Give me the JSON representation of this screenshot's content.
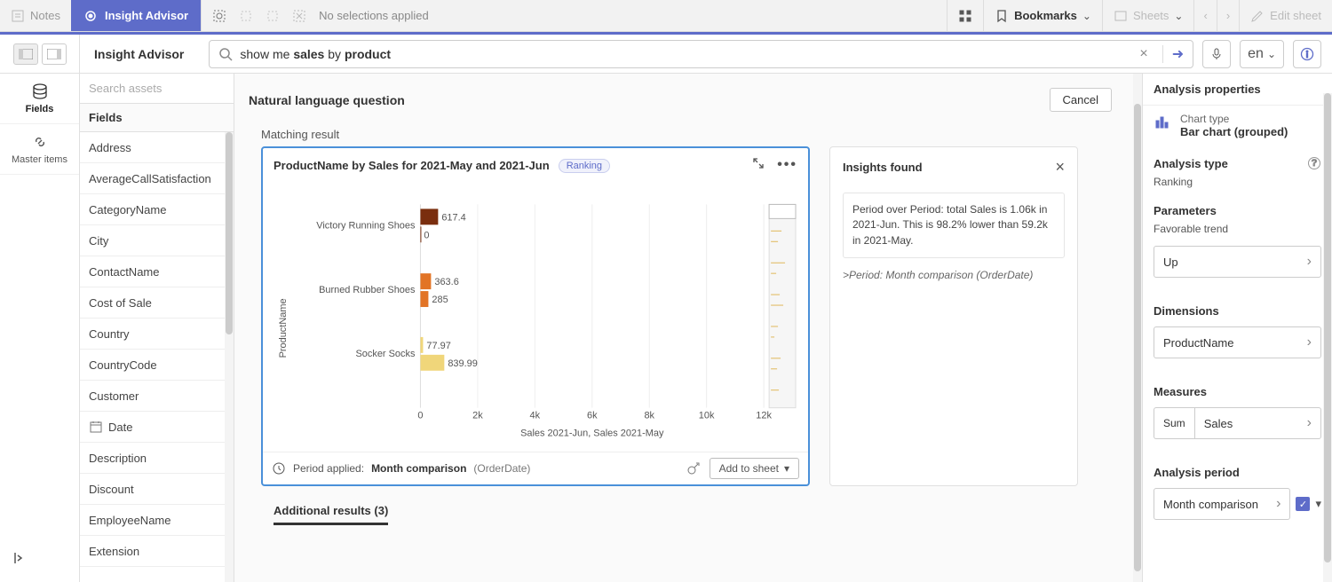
{
  "topbar": {
    "notes": "Notes",
    "insight": "Insight Advisor",
    "no_selections": "No selections applied",
    "bookmarks": "Bookmarks",
    "sheets": "Sheets",
    "edit_sheet": "Edit sheet"
  },
  "header": {
    "title": "Insight Advisor",
    "search_prefix": "show me ",
    "search_kw1": "sales",
    "search_mid": " by ",
    "search_kw2": "product",
    "lang": "en"
  },
  "leftnav": {
    "fields": "Fields",
    "master": "Master items"
  },
  "fields_panel": {
    "search_placeholder": "Search assets",
    "header": "Fields",
    "items": [
      "Address",
      "AverageCallSatisfaction",
      "CategoryName",
      "City",
      "ContactName",
      "Cost of Sale",
      "Country",
      "CountryCode",
      "Customer",
      "Date",
      "Description",
      "Discount",
      "EmployeeName",
      "Extension"
    ]
  },
  "main": {
    "nl_title": "Natural language question",
    "cancel": "Cancel",
    "matching": "Matching result",
    "additional": "Additional results (3)"
  },
  "chart_card": {
    "title": "ProductName by Sales for 2021-May and 2021-Jun",
    "badge": "Ranking",
    "period_applied_label": "Period applied:",
    "period_value": "Month comparison",
    "period_field": "(OrderDate)",
    "add_to_sheet": "Add to sheet"
  },
  "insights": {
    "title": "Insights found",
    "body": "Period over Period: total Sales is 1.06k in 2021-Jun. This is 98.2% lower than 59.2k in 2021-May.",
    "sub": ">Period: Month comparison (OrderDate)"
  },
  "right_panel": {
    "title": "Analysis properties",
    "chart_type_label": "Chart type",
    "chart_type_value": "Bar chart (grouped)",
    "analysis_type_label": "Analysis type",
    "analysis_type_value": "Ranking",
    "parameters": "Parameters",
    "favorable": "Favorable trend",
    "trend": "Up",
    "dimensions": "Dimensions",
    "dimension_value": "ProductName",
    "measures": "Measures",
    "agg": "Sum",
    "measure": "Sales",
    "analysis_period": "Analysis period",
    "period_value": "Month comparison"
  },
  "chart_data": {
    "type": "bar",
    "orientation": "horizontal",
    "title": "ProductName by Sales for 2021-May and 2021-Jun",
    "ylabel": "ProductName",
    "xlabel": "Sales 2021-Jun, Sales 2021-May",
    "xlim": [
      0,
      12000
    ],
    "xticks": [
      0,
      2000,
      4000,
      6000,
      8000,
      10000,
      12000
    ],
    "xtick_labels": [
      "0",
      "2k",
      "4k",
      "6k",
      "8k",
      "10k",
      "12k"
    ],
    "categories": [
      "Victory Running Shoes",
      "Burned Rubber Shoes",
      "Socker Socks"
    ],
    "series": [
      {
        "name": "Sales 2021-Jun",
        "color": "#7a2e0e",
        "colors_by_cat": [
          "#7a2e0e",
          "#e27426",
          "#f0c24a"
        ],
        "values": [
          617.4,
          363.6,
          77.97
        ]
      },
      {
        "name": "Sales 2021-May",
        "color": "#e27426",
        "colors_by_cat": [
          "#7a2e0e",
          "#e27426",
          "#f0c24a"
        ],
        "values": [
          0,
          285,
          839.99
        ]
      }
    ],
    "minimap": true
  }
}
